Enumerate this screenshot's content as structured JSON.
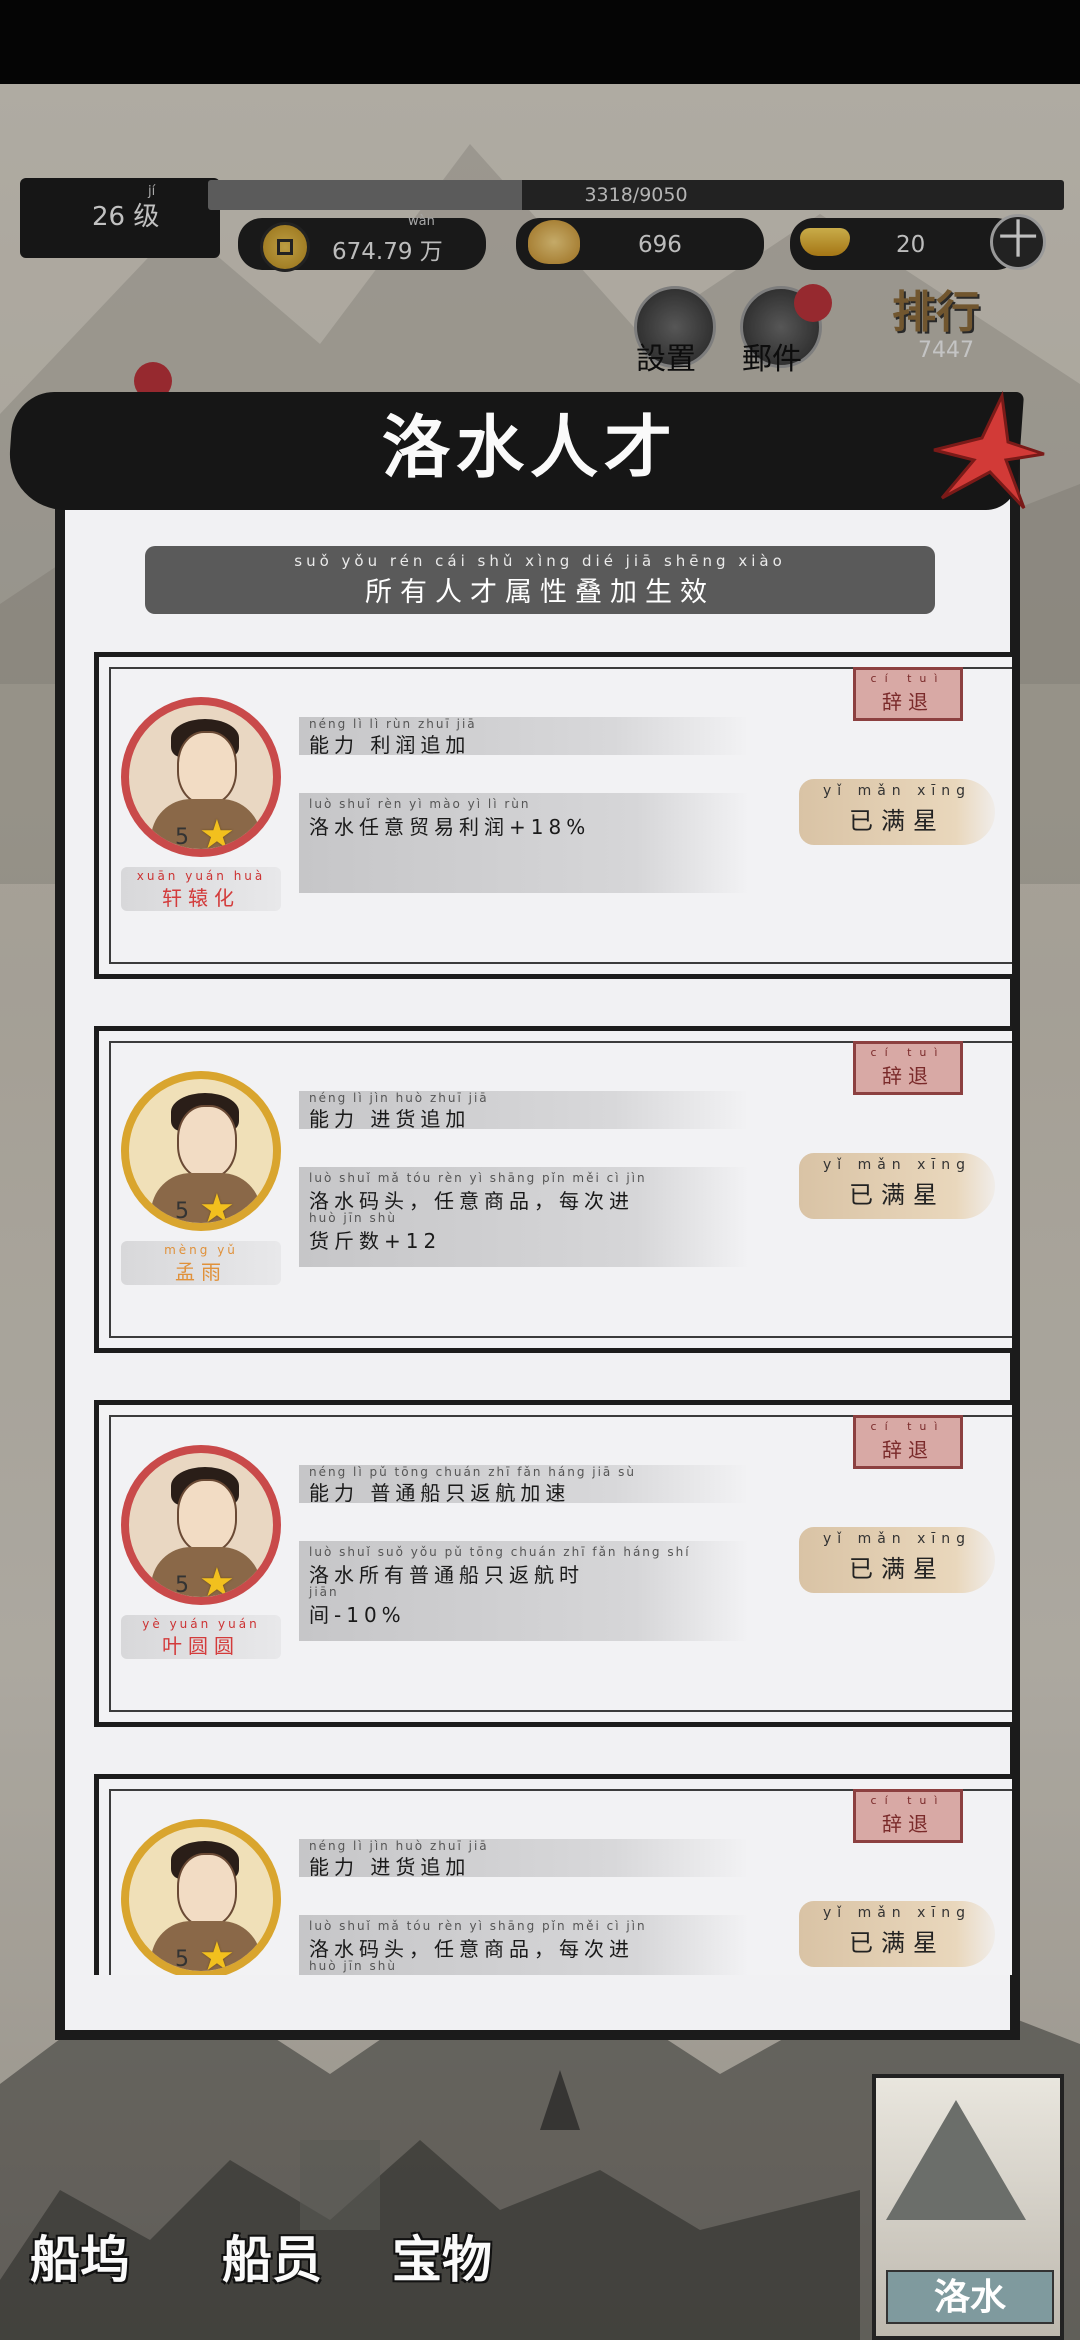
{
  "hud": {
    "level_pinyin": "jí",
    "level": "26 级",
    "exp_text": "3318/9050",
    "exp_ratio": 0.3666,
    "copper_pinyin": "wàn",
    "copper": "674.79 万",
    "shells": "696",
    "gold": "20",
    "plus_label": "十",
    "settings_label": "設置",
    "mail_label": "郵件",
    "rank_label": "排行",
    "rank_value": "7447"
  },
  "modal": {
    "title": "洛水人才",
    "subtitle_pinyin": "suǒ yǒu rén cái shǔ xìng dié jiā shēng xiào",
    "subtitle": "所有人才属性叠加生效"
  },
  "cards": [
    {
      "name_pinyin": "xuān yuán huà",
      "name": "轩辕化",
      "name_color": "red",
      "frame": "red",
      "stars": "5",
      "ability_pinyin": "néng  lì      lì  rùn zhuī  jiā",
      "ability": "能力 利润追加",
      "effect_pinyin_1": "luò shuǐ rèn  yì  mào  yì    lì   rùn",
      "effect_line_1": "洛水任意贸易利润+18%",
      "effect_pinyin_2": "",
      "effect_line_2": "",
      "dismiss_pinyin": "cí  tuì",
      "dismiss": "辞退",
      "maxstar_pinyin": "yǐ  mǎn xīng",
      "maxstar": "已满星"
    },
    {
      "name_pinyin": "mèng  yǔ",
      "name": "孟雨",
      "name_color": "orange",
      "frame": "gold",
      "stars": "5",
      "ability_pinyin": "néng  lì      jìn  huò zhuī  jiā",
      "ability": "能力 进货追加",
      "effect_pinyin_1": "luò shuǐ mǎ  tóu   rèn  yì  shāng pǐn   měi  cì   jìn",
      "effect_line_1": "洛水码头，任意商品，每次进",
      "effect_pinyin_2": "huò  jīn  shù",
      "effect_line_2": "货斤数+12",
      "dismiss_pinyin": "cí  tuì",
      "dismiss": "辞退",
      "maxstar_pinyin": "yǐ  mǎn xīng",
      "maxstar": "已满星"
    },
    {
      "name_pinyin": "yè  yuán yuán",
      "name": "叶圆圆",
      "name_color": "red",
      "frame": "red",
      "stars": "5",
      "ability_pinyin": "néng  lì     pǔ tōng chuán zhī  fǎn háng jiā  sù",
      "ability": "能力 普通船只返航加速",
      "effect_pinyin_1": "luò shuǐ suǒ yǒu pǔ tōng chuán zhī  fǎn háng shí",
      "effect_line_1": "洛水所有普通船只返航时",
      "effect_pinyin_2": "jiān",
      "effect_line_2": "间-10%",
      "dismiss_pinyin": "cí  tuì",
      "dismiss": "辞退",
      "maxstar_pinyin": "yǐ  mǎn xīng",
      "maxstar": "已满星"
    },
    {
      "name_pinyin": "",
      "name": "",
      "name_color": "orange",
      "frame": "gold",
      "stars": "5",
      "ability_pinyin": "néng  lì      jìn  huò zhuī  jiā",
      "ability": "能力 进货追加",
      "effect_pinyin_1": "luò shuǐ mǎ  tóu   rèn  yì  shāng pǐn   měi  cì   jìn",
      "effect_line_1": "洛水码头，任意商品，每次进",
      "effect_pinyin_2": "huò  jīn  shù",
      "effect_line_2": "",
      "dismiss_pinyin": "cí  tuì",
      "dismiss": "辞退",
      "maxstar_pinyin": "yǐ  mǎn xīng",
      "maxstar": "已满星"
    }
  ],
  "nav": {
    "shipyard": "船坞",
    "crew": "船员",
    "treasure": "宝物",
    "map_label": "洛水"
  }
}
